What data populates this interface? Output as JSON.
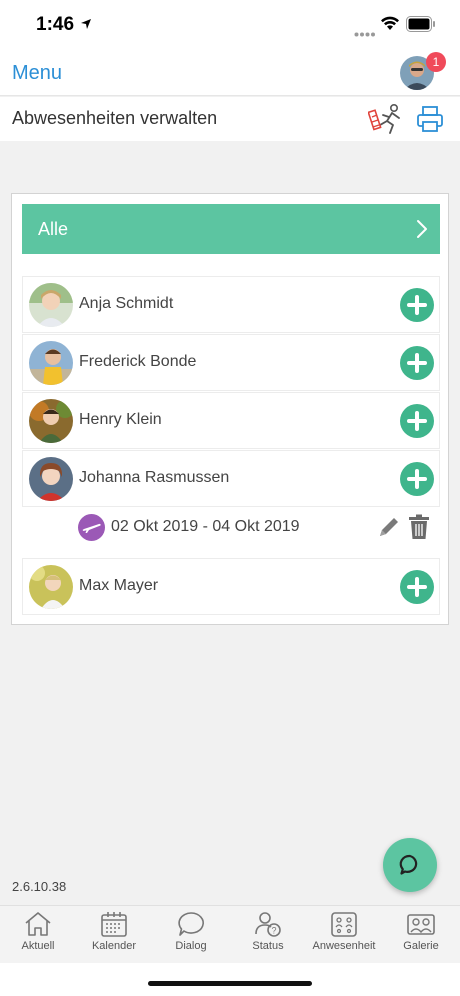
{
  "status": {
    "time": "1:46"
  },
  "nav": {
    "menu_label": "Menu",
    "badge_count": "1"
  },
  "header": {
    "title": "Abwesenheiten verwalten"
  },
  "filter": {
    "label": "Alle"
  },
  "children": [
    {
      "name": "Anja Schmidt"
    },
    {
      "name": "Frederick Bonde"
    },
    {
      "name": "Henry Klein"
    },
    {
      "name": "Johanna Rasmussen"
    },
    {
      "name": "Max Mayer"
    }
  ],
  "absence": {
    "range": "02 Okt 2019 - 04 Okt 2019"
  },
  "version": "2.6.10.38",
  "tabs": [
    {
      "label": "Aktuell",
      "icon": "home-icon"
    },
    {
      "label": "Kalender",
      "icon": "calendar-icon"
    },
    {
      "label": "Dialog",
      "icon": "speech-bubble-icon"
    },
    {
      "label": "Status",
      "icon": "status-person-icon"
    },
    {
      "label": "Anwesenheit",
      "icon": "attendance-icon"
    },
    {
      "label": "Galerie",
      "icon": "gallery-icon"
    }
  ],
  "colors": {
    "accent": "#5cc5a1",
    "add_button": "#3fb58c",
    "link": "#2c8fd6",
    "badge": "#f04a5a",
    "absence_type": "#9b59b6"
  }
}
